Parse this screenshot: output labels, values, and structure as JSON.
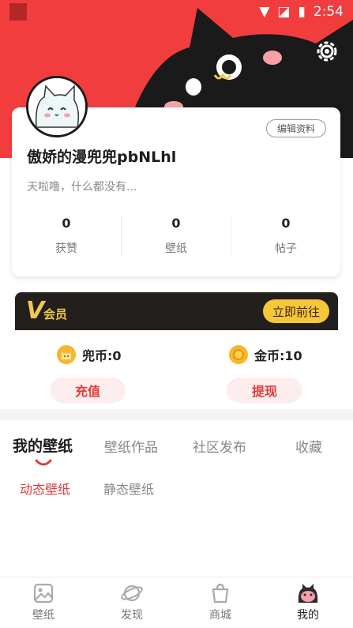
{
  "status_bar": {
    "time": "2:54"
  },
  "profile": {
    "edit_label": "编辑资料",
    "username": "傲娇的漫兜兜pbNLhl",
    "bio": "天啦噜，什么都没有...",
    "stats": [
      {
        "value": "0",
        "label": "获赞"
      },
      {
        "value": "0",
        "label": "壁纸"
      },
      {
        "value": "0",
        "label": "帖子"
      }
    ]
  },
  "vip": {
    "badge": "V",
    "label": "会员",
    "action_label": "立即前往"
  },
  "wallet": {
    "doudou": {
      "text": "兜币:0",
      "button_label": "充值"
    },
    "coins": {
      "text": "金币:10",
      "button_label": "提现"
    }
  },
  "tabs": [
    "我的壁纸",
    "壁纸作品",
    "社区发布",
    "收藏"
  ],
  "active_tab": "我的壁纸",
  "subtabs": [
    "动态壁纸",
    "静态壁纸"
  ],
  "active_subtab": "动态壁纸",
  "bottom_nav": [
    {
      "label": "壁纸",
      "icon": "image-icon"
    },
    {
      "label": "发现",
      "icon": "planet-icon"
    },
    {
      "label": "商城",
      "icon": "shop-icon"
    },
    {
      "label": "我的",
      "icon": "cat-avatar-icon"
    }
  ],
  "colors": {
    "accent": "#f23d3f",
    "active_text": "#e23c3c",
    "vip_gold": "#f6c739"
  }
}
